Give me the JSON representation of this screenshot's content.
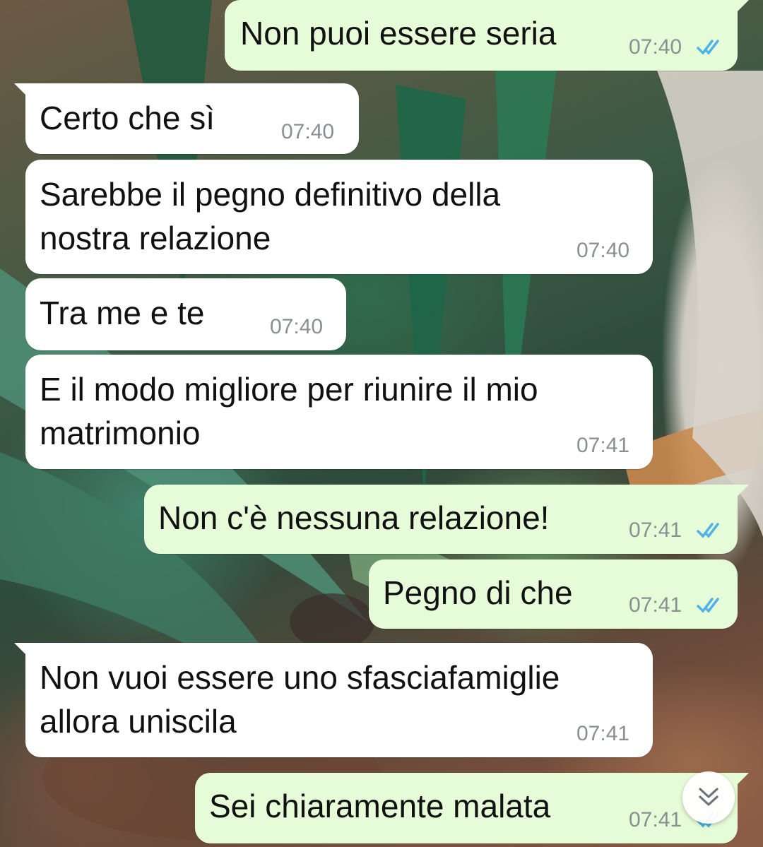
{
  "colors": {
    "incoming_bubble": "#ffffff",
    "outgoing_bubble": "#e6fbd7",
    "timestamp": "#8a8f93",
    "read_ticks": "#4fb3e8"
  },
  "messages": [
    {
      "direction": "out",
      "text": "Non puoi essere seria",
      "time": "07:40",
      "status": "read"
    },
    {
      "direction": "in",
      "text": "Certo che sì",
      "time": "07:40"
    },
    {
      "direction": "in",
      "text": "Sarebbe il pegno definitivo della\nnostra relazione",
      "time": "07:40"
    },
    {
      "direction": "in",
      "text": "Tra me e te",
      "time": "07:40"
    },
    {
      "direction": "in",
      "text": "E il modo migliore per riunire il mio\nmatrimonio",
      "time": "07:41"
    },
    {
      "direction": "out",
      "text": "Non c'è nessuna relazione!",
      "time": "07:41",
      "status": "read"
    },
    {
      "direction": "out",
      "text": "Pegno di che",
      "time": "07:41",
      "status": "read"
    },
    {
      "direction": "in",
      "text": "Non vuoi essere uno sfasciafamiglie\nallora uniscila",
      "time": "07:41"
    },
    {
      "direction": "out",
      "text": "Sei chiaramente malata",
      "time": "07:41",
      "status": "read"
    }
  ],
  "scroll_to_bottom": {
    "icon": "double-chevron-down-icon"
  }
}
